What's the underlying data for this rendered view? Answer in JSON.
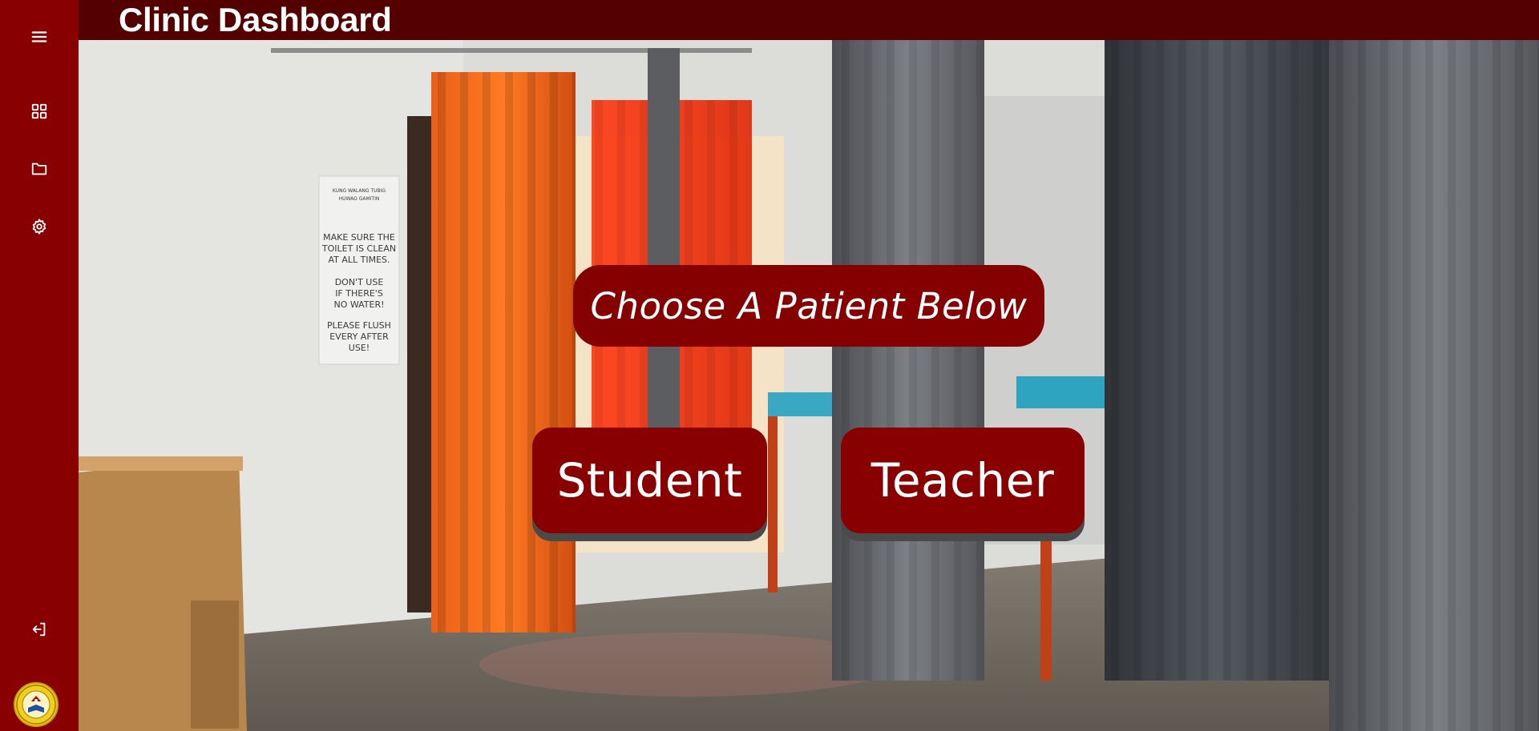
{
  "app": {
    "title": "Clinic Dashboard"
  },
  "sidebar": {
    "items": [
      {
        "name": "menu",
        "icon": "hamburger-menu-icon"
      },
      {
        "name": "dashboard",
        "icon": "dashboard-grid-icon"
      },
      {
        "name": "records",
        "icon": "folder-icon"
      },
      {
        "name": "settings",
        "icon": "gear-icon"
      },
      {
        "name": "logout",
        "icon": "logout-icon"
      }
    ],
    "logo_icon": "school-seal-icon"
  },
  "main": {
    "prompt": "Choose A Patient Below",
    "choices": [
      {
        "label": "Student"
      },
      {
        "label": "Teacher"
      }
    ],
    "sign_text": [
      "KUNG WALANG TUBIG",
      "HUWAG GAMITIN",
      "MAKE SURE THE",
      "TOILET IS CLEAN",
      "AT ALL TIMES.",
      "DON'T USE",
      "IF THERE'S",
      "NO WATER!",
      "PLEASE FLUSH",
      "EVERY AFTER",
      "USE!"
    ]
  },
  "colors": {
    "sidebar": "#880000",
    "topbar": "#550000",
    "button": "#880000",
    "button_shadow": "#4a4a4a",
    "text": "#ffffff"
  }
}
